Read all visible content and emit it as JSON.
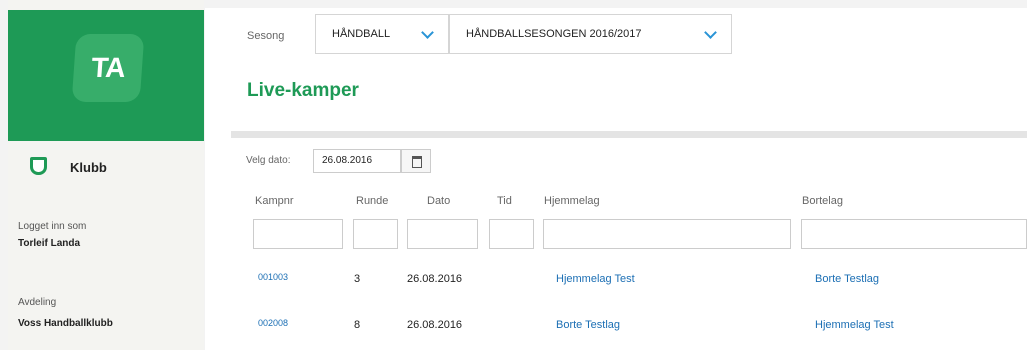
{
  "sidebar": {
    "logo_text": "TA",
    "club_label": "Klubb",
    "logged_in_label": "Logget inn som",
    "user_name": "Torleif Landa",
    "department_label": "Avdeling",
    "department_value": "Voss Handballklubb"
  },
  "filters": {
    "season_label": "Sesong",
    "sport_select": "HÅNDBALL",
    "season_select": "HÅNDBALLSESONGEN 2016/2017"
  },
  "page_title": "Live-kamper",
  "date_picker": {
    "label": "Velg dato:",
    "value": "26.08.2016",
    "icon": "calendar-icon"
  },
  "table": {
    "columns": [
      "Kampnr",
      "Runde",
      "Dato",
      "Tid",
      "Hjemmelag",
      "Bortelag"
    ],
    "rows": [
      {
        "kampnr": "001003",
        "runde": "3",
        "dato": "26.08.2016",
        "tid": "",
        "hjemmelag": "Hjemmelag Test",
        "bortelag": "Borte Testlag"
      },
      {
        "kampnr": "002008",
        "runde": "8",
        "dato": "26.08.2016",
        "tid": "",
        "hjemmelag": "Borte Testlag",
        "bortelag": "Hjemmelag Test"
      }
    ]
  },
  "colors": {
    "brand_green": "#1e9a56",
    "link_blue": "#1c6fb4",
    "chevron_blue": "#2a94d6"
  }
}
